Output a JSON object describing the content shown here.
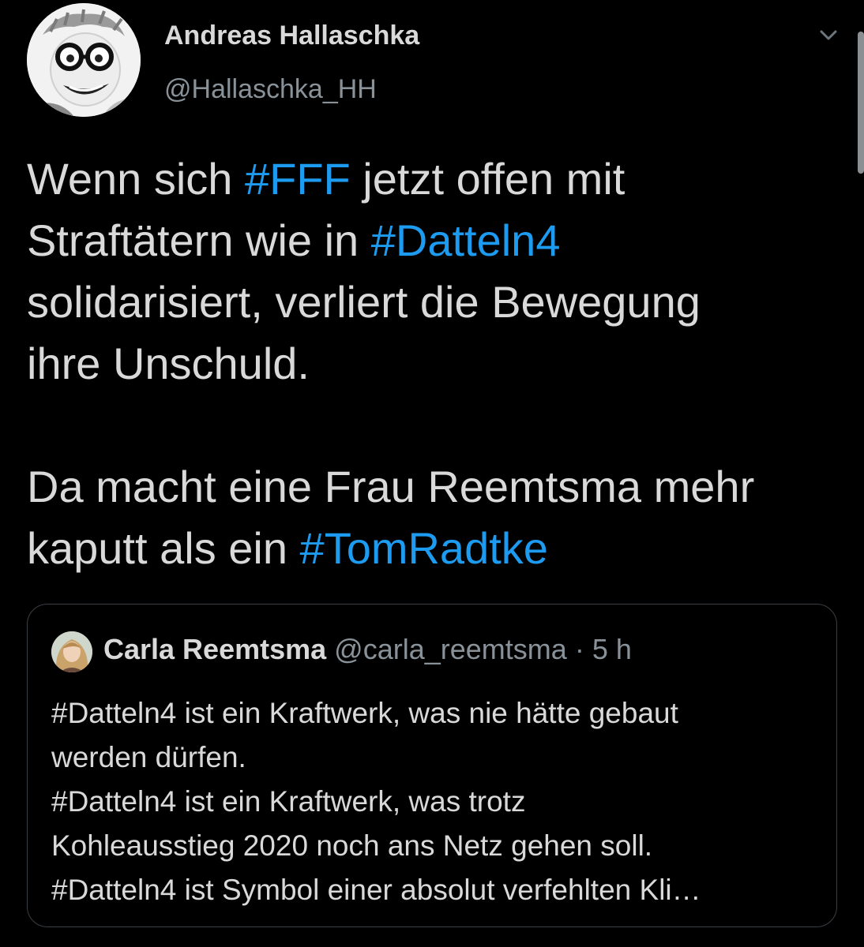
{
  "author": {
    "name": "Andreas Hallaschka",
    "handle": "@Hallaschka_HH"
  },
  "tweet": {
    "line1": {
      "pre": "Wenn sich ",
      "tag": "#FFF",
      "post": " jetzt offen mit"
    },
    "line2": {
      "pre": "Straftätern wie in ",
      "tag": "#Datteln4"
    },
    "line3": "solidarisiert, verliert die Bewegung",
    "line4": "ihre Unschuld.",
    "line5": "Da macht eine Frau Reemtsma mehr",
    "line6": {
      "pre": "kaputt als ein ",
      "tag": "#TomRadtke"
    }
  },
  "quoted_tweet": {
    "name": "Carla Reemtsma",
    "handle": "@carla_reemtsma",
    "separator": "·",
    "time": "5 h",
    "lines": [
      "#Datteln4 ist ein Kraftwerk, was nie hätte gebaut",
      "werden dürfen.",
      "#Datteln4 ist ein Kraftwerk, was trotz",
      "Kohleausstieg 2020 noch ans Netz gehen soll.",
      "#Datteln4 ist Symbol einer absolut verfehlten Kli…"
    ]
  },
  "icons": {
    "menu": "chevron-down-icon"
  },
  "colors": {
    "background": "#000000",
    "text": "#d9d9d9",
    "secondary": "#8a9299",
    "hashtag": "#1d9bf0",
    "card_border": "#3a3f44"
  }
}
